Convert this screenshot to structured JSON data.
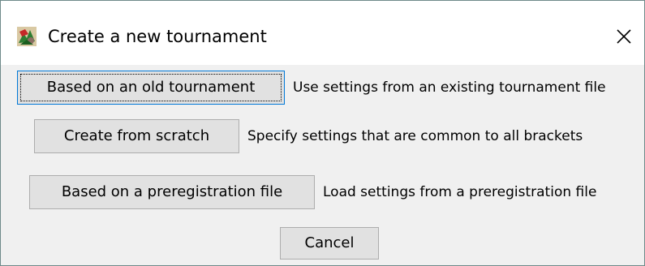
{
  "window": {
    "title": "Create a new tournament",
    "app_icon": "tournament-app-icon",
    "close_icon": "close-icon"
  },
  "options": [
    {
      "button_label": "Based on an old tournament",
      "description": "Use settings from an existing tournament file",
      "focused": true
    },
    {
      "button_label": "Create from scratch",
      "description": "Specify settings that are common to all brackets",
      "focused": false
    },
    {
      "button_label": "Based on a preregistration file",
      "description": "Load settings from a preregistration file",
      "focused": false
    }
  ],
  "cancel_label": "Cancel",
  "colors": {
    "client_background": "#f0f0f0",
    "button_face": "#e1e1e1",
    "button_border": "#adadad",
    "focus_border": "#0078d7"
  }
}
